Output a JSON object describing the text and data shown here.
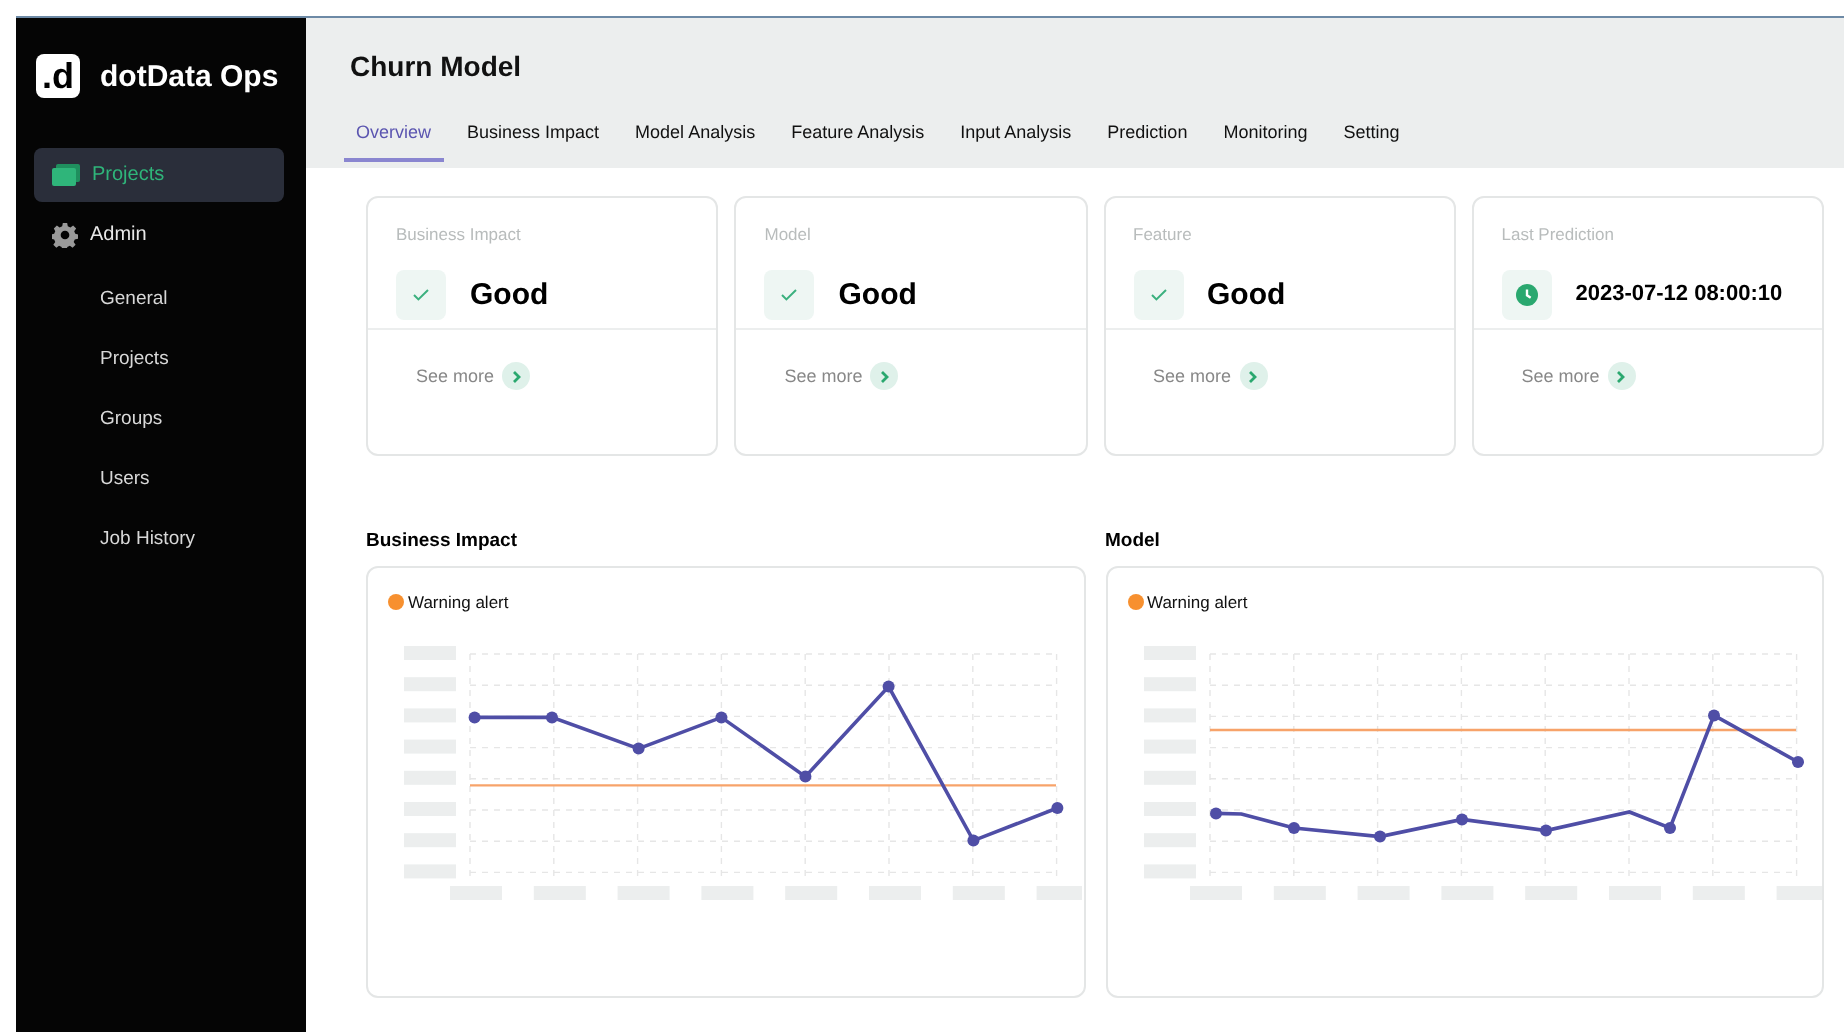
{
  "app": {
    "logo_mark": ".d",
    "name": "dotData Ops"
  },
  "sidebar": {
    "items": [
      {
        "label": "Projects",
        "kind": "folder",
        "selected": true
      },
      {
        "label": "Admin",
        "kind": "gear",
        "selected": false,
        "children": [
          {
            "label": "General",
            "selected": false
          },
          {
            "label": "Projects",
            "selected": false
          },
          {
            "label": "Groups",
            "selected": false
          },
          {
            "label": "Users",
            "selected": false
          },
          {
            "label": "Job History",
            "selected": false
          }
        ]
      }
    ]
  },
  "header": {
    "title": "Churn Model"
  },
  "tabs": [
    {
      "label": "Overview",
      "selected": true
    },
    {
      "label": "Business Impact",
      "selected": false
    },
    {
      "label": "Model Analysis",
      "selected": false
    },
    {
      "label": "Feature Analysis",
      "selected": false
    },
    {
      "label": "Input Analysis",
      "selected": false
    },
    {
      "label": "Prediction",
      "selected": false
    },
    {
      "label": "Monitoring",
      "selected": false
    },
    {
      "label": "Setting",
      "selected": false
    }
  ],
  "cards": [
    {
      "title": "Business Impact",
      "kind": "check",
      "value": "Good",
      "link": "See more"
    },
    {
      "title": "Model",
      "kind": "check",
      "value": "Good",
      "link": "See more"
    },
    {
      "title": "Feature",
      "kind": "check",
      "value": "Good",
      "link": "See more"
    },
    {
      "title": "Last Prediction",
      "kind": "clock",
      "value": "2023-07-12 08:00:10",
      "link": "See more"
    }
  ],
  "charts": [
    {
      "title": "Business Impact",
      "legend": "Warning alert"
    },
    {
      "title": "Model",
      "legend": "Warning alert"
    }
  ]
}
